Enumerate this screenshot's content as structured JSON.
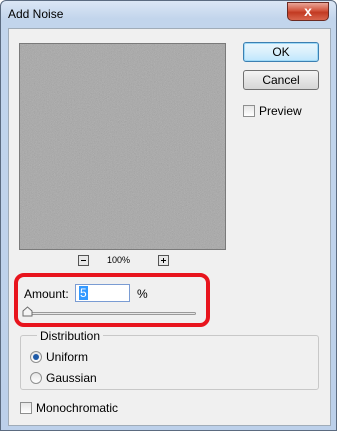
{
  "window": {
    "title": "Add Noise",
    "close_label": "x"
  },
  "preview": {
    "zoom": "100%"
  },
  "buttons": {
    "ok": "OK",
    "cancel": "Cancel"
  },
  "preview_toggle": {
    "label": "Preview",
    "checked": false
  },
  "amount": {
    "label": "Amount:",
    "value": "5",
    "unit": "%"
  },
  "distribution": {
    "legend": "Distribution",
    "options": [
      {
        "label": "Uniform",
        "selected": true
      },
      {
        "label": "Gaussian",
        "selected": false
      }
    ]
  },
  "monochromatic": {
    "label": "Monochromatic",
    "checked": false
  },
  "colors": {
    "highlight": "#e8141d",
    "noise_base": "#7f7f7f"
  }
}
